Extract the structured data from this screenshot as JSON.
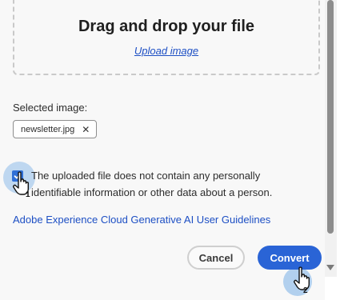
{
  "dropzone": {
    "title": "Drag and drop your file",
    "upload_link": "Upload image"
  },
  "selected": {
    "label": "Selected image:",
    "file_name": "newsletter.jpg",
    "remove_symbol": "✕"
  },
  "consent": {
    "checked": true,
    "text": "The uploaded file does not contain any personally identifiable information or other data about a person."
  },
  "guidelines_link": "Adobe Experience Cloud Generative AI User Guidelines",
  "buttons": {
    "cancel": "Cancel",
    "convert": "Convert"
  },
  "annotations": {
    "step1": "1",
    "step2": "2"
  },
  "colors": {
    "accent": "#2a64d6",
    "link": "#1d4fc4",
    "highlight": "#78afe6"
  },
  "icons": {
    "checkbox": "checkmark-icon",
    "remove": "close-icon",
    "pointer": "hand-pointer-icon",
    "scroll": "chevron-down-icon"
  }
}
